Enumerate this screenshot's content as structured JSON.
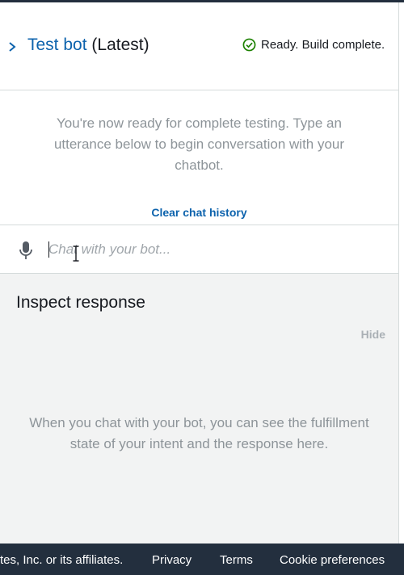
{
  "header": {
    "bot_name": "Test bot",
    "version_label": "(Latest)",
    "status_text": "Ready. Build complete.",
    "status_color": "#1d8102",
    "link_color": "#0d63ad"
  },
  "conversation": {
    "welcome_text": "You're now ready for complete testing. Type an utterance below to begin conversation with your chatbot.",
    "clear_label": "Clear chat history"
  },
  "chat_input": {
    "value": "",
    "placeholder": "Chat with your bot...",
    "mic_icon": "microphone-icon"
  },
  "inspect": {
    "title": "Inspect response",
    "hide_label": "Hide",
    "info_text": "When you chat with your bot, you can see the fulfillment state of your intent and the response here."
  },
  "footer": {
    "copyright_fragment": "tes, Inc. or its affiliates.",
    "links": [
      "Privacy",
      "Terms",
      "Cookie preferences"
    ]
  }
}
